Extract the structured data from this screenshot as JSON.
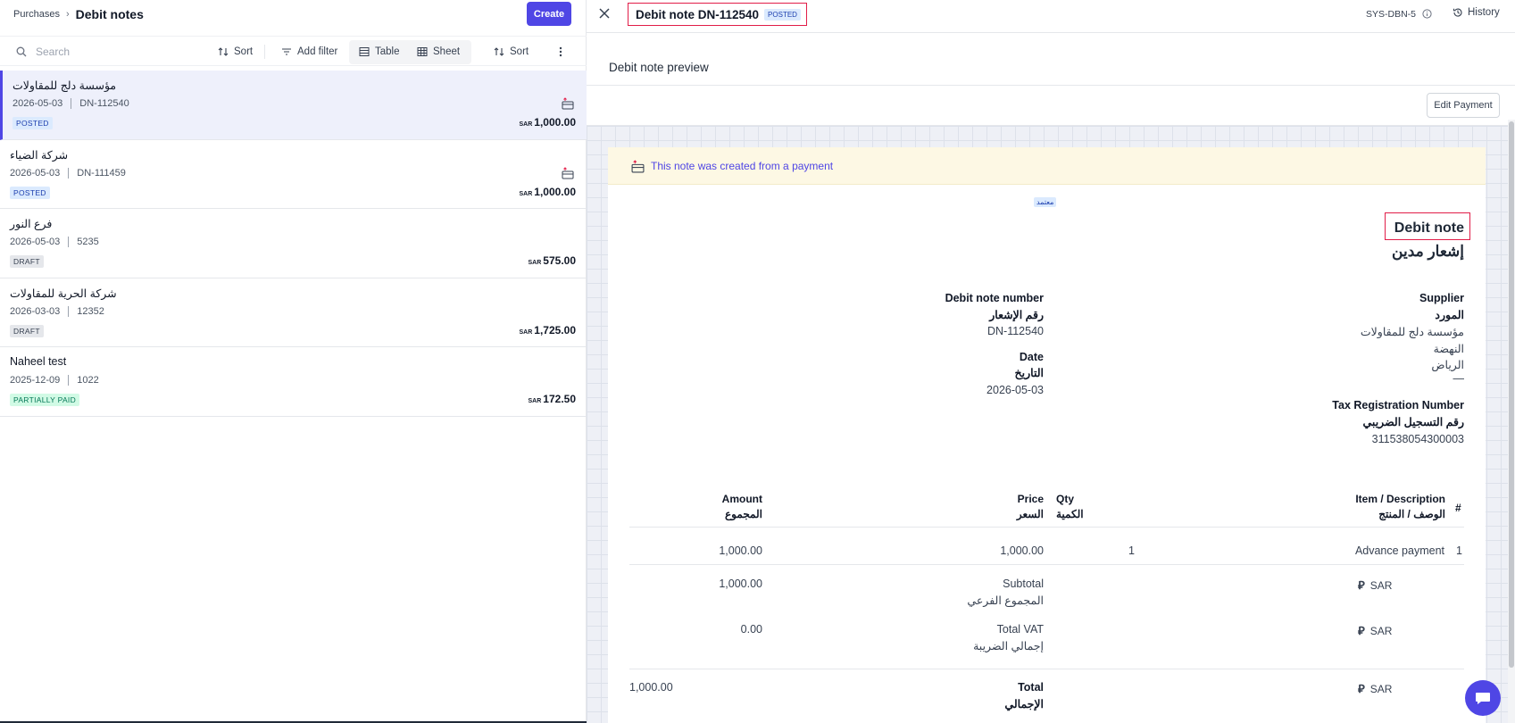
{
  "breadcrumb": {
    "parent": "Purchases",
    "separator": "›",
    "current": "Debit notes"
  },
  "create_label": "Create",
  "toolbar": {
    "search_placeholder": "Search",
    "sort_label": "Sort",
    "add_filter_label": "Add filter",
    "table_label": "Table",
    "sheet_label": "Sheet",
    "sort2_label": "Sort"
  },
  "list": [
    {
      "name": "مؤسسة دلج للمقاولات",
      "date": "2026-05-03",
      "number": "DN-112540",
      "status": "POSTED",
      "currency": "SAR",
      "amount": "1,000.00",
      "from_payment": true
    },
    {
      "name": "شركة الضياء",
      "date": "2026-05-03",
      "number": "DN-111459",
      "status": "POSTED",
      "currency": "SAR",
      "amount": "1,000.00",
      "from_payment": true
    },
    {
      "name": "فرع النور",
      "date": "2026-05-03",
      "number": "5235",
      "status": "DRAFT",
      "currency": "SAR",
      "amount": "575.00",
      "from_payment": false
    },
    {
      "name": "شركة الحرية للمقاولات",
      "date": "2026-03-03",
      "number": "12352",
      "status": "DRAFT",
      "currency": "SAR",
      "amount": "1,725.00",
      "from_payment": false
    },
    {
      "name": "Naheel test",
      "date": "2025-12-09",
      "number": "1022",
      "status": "PARTIALLY PAID",
      "currency": "SAR",
      "amount": "172.50",
      "from_payment": false
    }
  ],
  "detail": {
    "title": "Debit note DN-112540",
    "status": "POSTED",
    "sys_id": "SYS-DBN-5",
    "history_label": "History",
    "preview_label": "Debit note preview",
    "edit_payment_label": "Edit Payment",
    "notice": "This note was created from a payment",
    "stamp": "معتمد",
    "doc_title": "Debit note",
    "doc_title_ar": "إشعار مدين",
    "supplier": {
      "label": "Supplier",
      "label_ar": "المورد",
      "name": "مؤسسة دلج للمقاولات",
      "district": "النهضة",
      "city": "الرياض",
      "extra": "—"
    },
    "tax": {
      "label": "Tax Registration Number",
      "label_ar": "رقم التسجيل الضريبي",
      "value": "311538054300003"
    },
    "number": {
      "label": "Debit note number",
      "label_ar": "رقم الإشعار",
      "value": "DN-112540"
    },
    "date": {
      "label": "Date",
      "label_ar": "التاريخ",
      "value": "2026-05-03"
    },
    "table": {
      "col_num": "#",
      "col_item": "Item / Description",
      "col_item_ar": "الوصف / المنتج",
      "col_qty": "Qty",
      "col_qty_ar": "الكمية",
      "col_price": "Price",
      "col_price_ar": "السعر",
      "col_amount": "Amount",
      "col_amount_ar": "المجموع",
      "rows": [
        {
          "num": "1",
          "item": "Advance payment",
          "qty": "1",
          "price": "1,000.00",
          "amount": "1,000.00"
        }
      ]
    },
    "totals": {
      "currency": "SAR",
      "currency_symbol": "⃁",
      "subtotal_label": "Subtotal",
      "subtotal_label_ar": "المجموع الفرعي",
      "subtotal": "1,000.00",
      "vat_label": "Total VAT",
      "vat_label_ar": "إجمالي الضريبة",
      "vat": "0.00",
      "total_label": "Total",
      "total_label_ar": "الإجمالي",
      "total": "1,000.00"
    }
  },
  "colors": {
    "accent": "#4f46e5",
    "highlight_box": "#e11d48"
  }
}
